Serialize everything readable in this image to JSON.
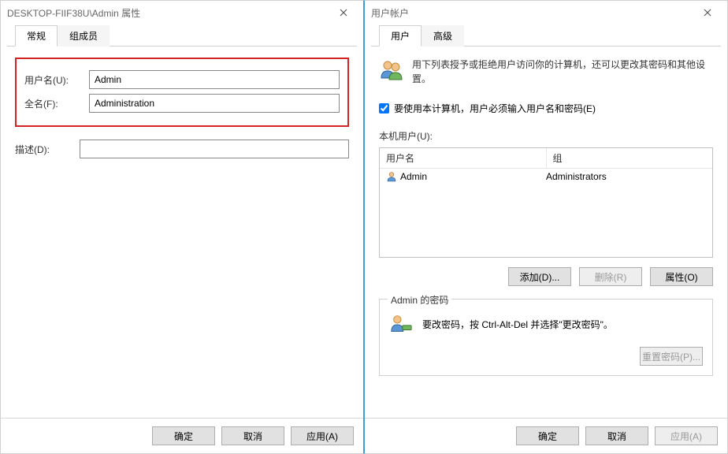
{
  "leftDialog": {
    "title": "DESKTOP-FIIF38U\\Admin 属性",
    "tabs": [
      {
        "label": "常规",
        "active": true
      },
      {
        "label": "组成员",
        "active": false
      }
    ],
    "fields": {
      "usernameLabel": "用户名(U):",
      "usernameValue": "Admin",
      "fullnameLabel": "全名(F):",
      "fullnameValue": "Administration",
      "descLabel": "描述(D):",
      "descValue": ""
    },
    "buttons": {
      "ok": "确定",
      "cancel": "取消",
      "apply": "应用(A)"
    }
  },
  "rightDialog": {
    "title": "用户帐户",
    "tabs": [
      {
        "label": "用户",
        "active": true
      },
      {
        "label": "高级",
        "active": false
      }
    ],
    "description": "用下列表授予或拒绝用户访问你的计算机，还可以更改其密码和其他设置。",
    "checkbox": {
      "label": "要使用本计算机，用户必须输入用户名和密码(E)",
      "checked": true
    },
    "listLabel": "本机用户(U):",
    "columns": {
      "user": "用户名",
      "group": "组"
    },
    "rows": [
      {
        "user": "Admin",
        "group": "Administrators"
      }
    ],
    "listButtons": {
      "add": "添加(D)...",
      "delete": "删除(R)",
      "properties": "属性(O)"
    },
    "groupbox": {
      "title": "Admin 的密码",
      "text": "要改密码，按 Ctrl-Alt-Del 并选择\"更改密码\"。",
      "reset": "重置密码(P)..."
    },
    "buttons": {
      "ok": "确定",
      "cancel": "取消",
      "apply": "应用(A)"
    }
  }
}
